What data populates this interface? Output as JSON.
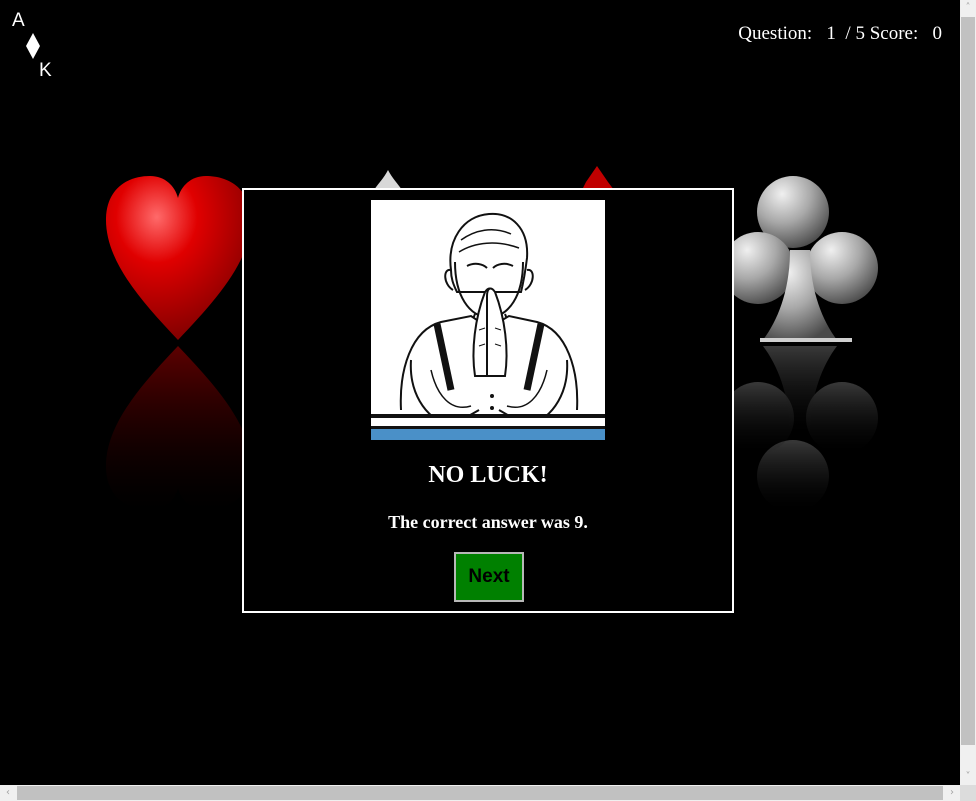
{
  "logo": {
    "top_letter": "A",
    "bottom_letter": "K",
    "suit_icon": "diamond-icon"
  },
  "hud": {
    "question_label": "Question:",
    "question_current": "1",
    "question_total": "/ 5",
    "score_label": "Score:",
    "score_value": "0"
  },
  "background_suits": [
    "heart-icon",
    "spade-icon",
    "diamond-icon",
    "club-icon"
  ],
  "modal": {
    "illustration_icon": "facepalm-man-icon",
    "title": "NO LUCK!",
    "message": "The correct answer was 9.",
    "next_label": "Next"
  },
  "colors": {
    "background": "#000000",
    "heart": "#d40000",
    "club": "#a8a8a8",
    "next_button": "#008000",
    "illustration_stripe": "#4a90c8"
  }
}
